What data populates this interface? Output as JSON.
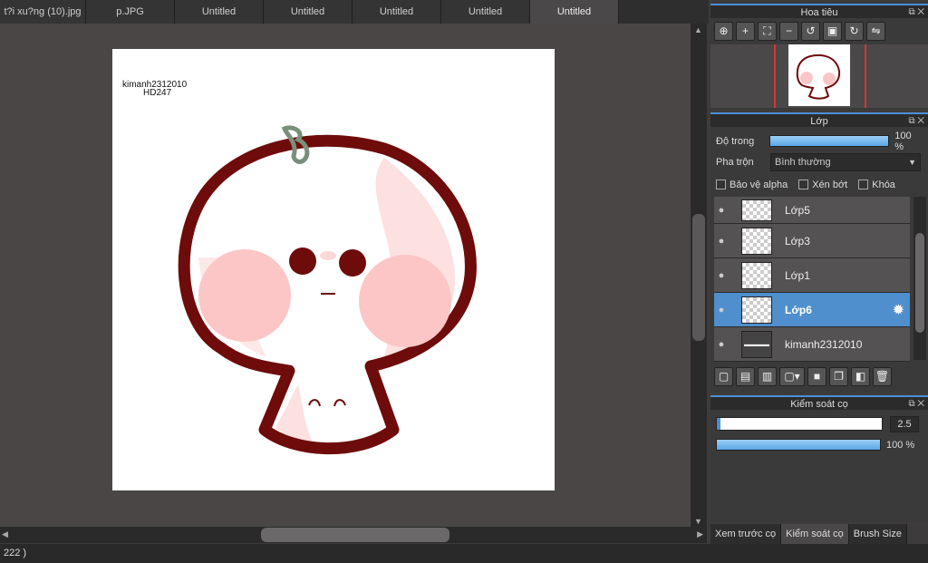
{
  "tabs": [
    {
      "label": "t?i xu?ng (10).jpg",
      "active": false
    },
    {
      "label": "p.JPG",
      "active": false
    },
    {
      "label": "Untitled",
      "active": false
    },
    {
      "label": "Untitled",
      "active": false
    },
    {
      "label": "Untitled",
      "active": false
    },
    {
      "label": "Untitled",
      "active": false
    },
    {
      "label": "Untitled",
      "active": true
    }
  ],
  "canvas": {
    "watermark_line1": "kimanh2312010",
    "watermark_line2": "HD247"
  },
  "status": "222 )",
  "navigator": {
    "title": "Hoa tiêu",
    "icons": [
      "zoom-fit-icon",
      "zoom-in-icon",
      "fit-screen-icon",
      "zoom-out-icon",
      "rotate-left-icon",
      "actual-size-icon",
      "rotate-right-icon",
      "flip-icon"
    ]
  },
  "layers_panel": {
    "title": "Lớp",
    "opacity_label": "Độ trong",
    "opacity_value": "100 %",
    "opacity_fraction": 1.0,
    "blend_label": "Pha trộn",
    "blend_value": "Bình thường",
    "protect_alpha_label": "Bảo vệ alpha",
    "clipping_label": "Xén bớt",
    "lock_label": "Khóa",
    "layers": [
      {
        "name": "Lớp5",
        "selected": false
      },
      {
        "name": "Lớp3",
        "selected": false
      },
      {
        "name": "Lớp1",
        "selected": false
      },
      {
        "name": "Lớp6",
        "selected": true
      },
      {
        "name": "kimanh2312010",
        "selected": false
      }
    ]
  },
  "brush_panel": {
    "title": "Kiểm soát cọ",
    "size_value": "2.5",
    "size_fraction": 0.02,
    "opacity_value": "100 %",
    "opacity_fraction": 1.0
  },
  "bottom_tabs": [
    {
      "label": "Xem trước cọ",
      "active": false
    },
    {
      "label": "Kiểm soát cọ",
      "active": true
    },
    {
      "label": "Brush Size",
      "active": false
    }
  ]
}
